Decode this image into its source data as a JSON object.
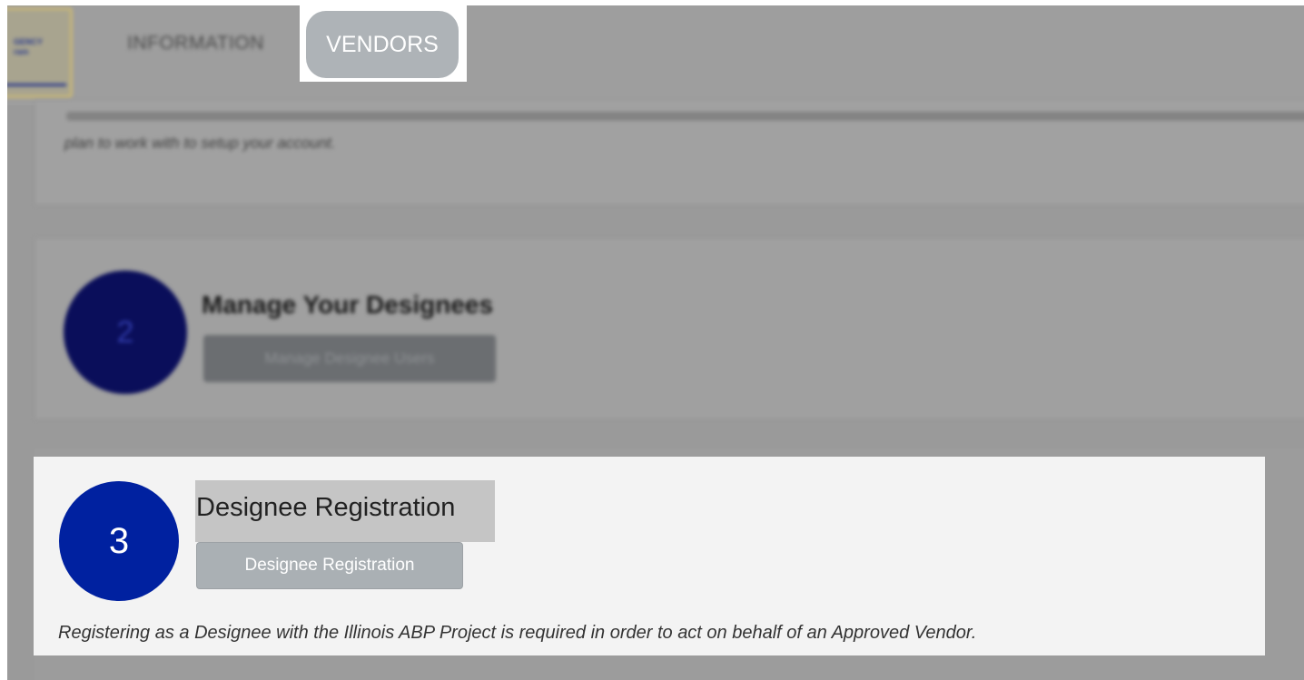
{
  "navbar": {
    "logo_text": "GENCY\nram",
    "information_label": "INFORMATION",
    "vendors_label": "VENDORS"
  },
  "steps": [
    {
      "description_tail": "plan to work with to setup your account."
    },
    {
      "number": "2",
      "title": "Manage Your Designees",
      "button_label": "Manage Designee Users"
    },
    {
      "number": "3",
      "title": "Designee Registration",
      "button_label": "Designee Registration",
      "description": "Registering as a Designee with the Illinois ABP Project is required in order to act on behalf of an Approved Vendor."
    }
  ],
  "colors": {
    "step3_circle": "#0021a0",
    "step2_circle": "#0a0e5a",
    "button_gray": "#aab0b4",
    "overlay_gray": "#9a9a9a"
  }
}
